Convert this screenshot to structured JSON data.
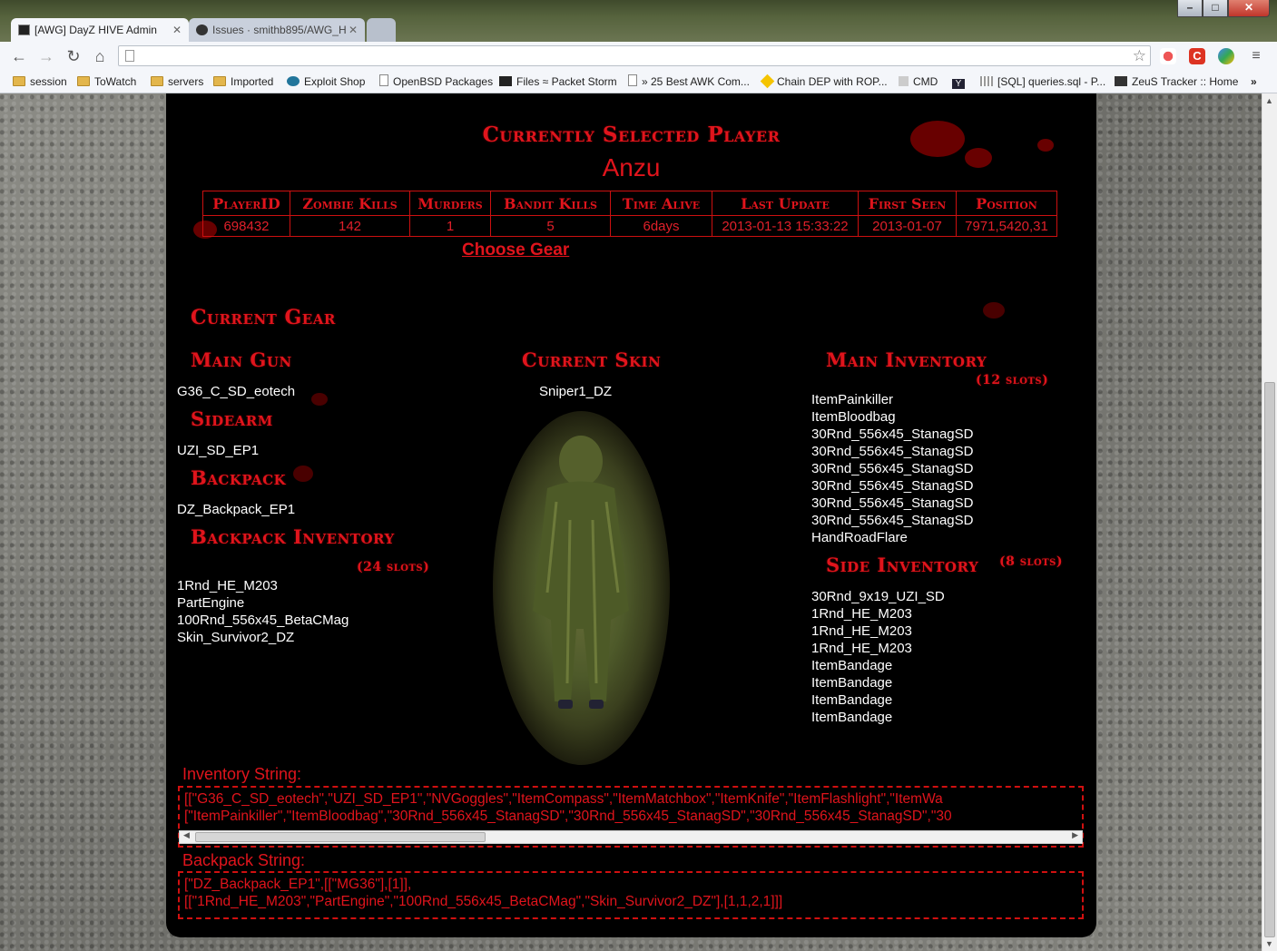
{
  "browser": {
    "tabs": [
      {
        "title": "[AWG] DayZ HIVE Admin",
        "active": true
      },
      {
        "title": "Issues · smithb895/AWG_H",
        "active": false
      }
    ],
    "url": "",
    "bookmarks": [
      "session",
      "ToWatch",
      "servers",
      "Imported",
      "Exploit Shop",
      "OpenBSD Packages",
      "Files ≈ Packet Storm",
      "» 25 Best AWK Com...",
      "Chain DEP with ROP...",
      "CMD",
      "[SQL] queries.sql - P...",
      "ZeuS Tracker :: Home"
    ],
    "overflow": "»"
  },
  "player": {
    "heading": "Currently Selected Player",
    "name": "Anzu",
    "columns": [
      "PlayerID",
      "Zombie Kills",
      "Murders",
      "Bandit Kills",
      "Time Alive",
      "Last Update",
      "First Seen",
      "Position"
    ],
    "values": [
      "698432",
      "142",
      "1",
      "5",
      "6days",
      "2013-01-13 15:33:22",
      "2013-01-07",
      "7971,5420,31"
    ],
    "choose_gear": "Choose Gear"
  },
  "gear": {
    "heading": "Current Gear",
    "main_gun_label": "Main Gun",
    "main_gun": "G36_C_SD_eotech",
    "sidearm_label": "Sidearm",
    "sidearm": "UZI_SD_EP1",
    "backpack_label": "Backpack",
    "backpack": "DZ_Backpack_EP1",
    "backpack_inv_label": "Backpack Inventory",
    "backpack_inv_slots": "(24 slots)",
    "backpack_items": [
      "1Rnd_HE_M203",
      "PartEngine",
      "100Rnd_556x45_BetaCMag",
      "Skin_Survivor2_DZ"
    ],
    "skin_label": "Current Skin",
    "skin": "Sniper1_DZ",
    "main_inv_label": "Main Inventory",
    "main_inv_slots": "(12 slots)",
    "main_items": [
      "ItemPainkiller",
      "ItemBloodbag",
      "30Rnd_556x45_StanagSD",
      "30Rnd_556x45_StanagSD",
      "30Rnd_556x45_StanagSD",
      "30Rnd_556x45_StanagSD",
      "30Rnd_556x45_StanagSD",
      "30Rnd_556x45_StanagSD",
      "HandRoadFlare"
    ],
    "side_inv_label": "Side Inventory",
    "side_inv_slots": "(8 slots)",
    "side_items": [
      "30Rnd_9x19_UZI_SD",
      "1Rnd_HE_M203",
      "1Rnd_HE_M203",
      "1Rnd_HE_M203",
      "ItemBandage",
      "ItemBandage",
      "ItemBandage",
      "ItemBandage"
    ]
  },
  "strings": {
    "inventory_label": "Inventory String:",
    "inventory_line1": "[[\"G36_C_SD_eotech\",\"UZI_SD_EP1\",\"NVGoggles\",\"ItemCompass\",\"ItemMatchbox\",\"ItemKnife\",\"ItemFlashlight\",\"ItemWa",
    "inventory_line2": "[\"ItemPainkiller\",\"ItemBloodbag\",\"30Rnd_556x45_StanagSD\",\"30Rnd_556x45_StanagSD\",\"30Rnd_556x45_StanagSD\",\"30",
    "backpack_label": "Backpack String:",
    "backpack_line1": "[\"DZ_Backpack_EP1\",[[\"MG36\"],[1]],",
    "backpack_line2": "[[\"1Rnd_HE_M203\",\"PartEngine\",\"100Rnd_556x45_BetaCMag\",\"Skin_Survivor2_DZ\"],[1,1,2,1]]]"
  },
  "colors": {
    "accent": "#e0141c",
    "panel": "#000000",
    "text": "#ffffff"
  }
}
